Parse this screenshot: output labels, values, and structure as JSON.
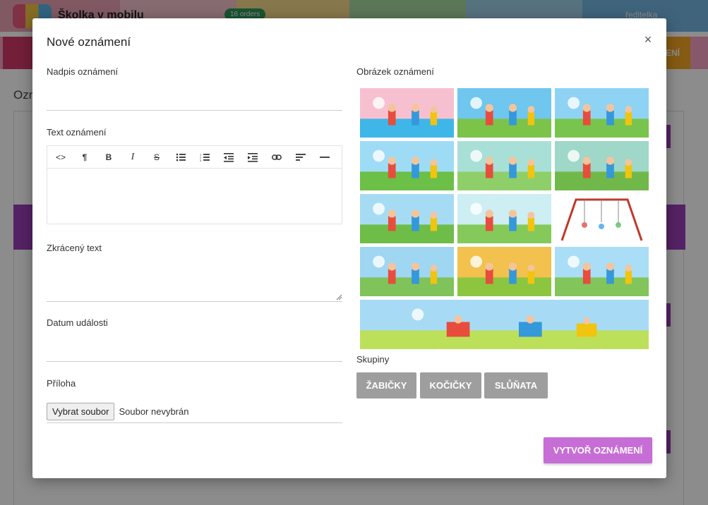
{
  "background": {
    "brand_name": "Školka v mobilu",
    "orders_badge": "16 orders",
    "role": "ředitelka",
    "nav_right_label": "ENÍ",
    "page_title": "Ozn",
    "topbar_colors": [
      "#e9a3b5",
      "#f4c4cc",
      "#f6d98a",
      "#a8d8a0",
      "#9fd0e8",
      "#74b6e2"
    ],
    "navbar_colors": [
      "#d33a6a",
      "#f4a0c0",
      "#f5a623"
    ]
  },
  "modal": {
    "title": "Nové oznámení",
    "close_icon": "close-icon",
    "fields": {
      "headline_label": "Nadpis oznámení",
      "headline_value": "",
      "text_label": "Text oznámení",
      "short_text_label": "Zkrácený text",
      "short_text_value": "",
      "event_date_label": "Datum události",
      "event_date_value": "",
      "attachment_label": "Příloha",
      "file_button": "Vybrat soubor",
      "file_status": "Soubor nevybrán"
    },
    "editor_toolbar": [
      {
        "icon": "code-icon",
        "glyph": "<>"
      },
      {
        "icon": "paragraph-icon",
        "glyph": "¶"
      },
      {
        "icon": "bold-icon",
        "glyph": "B"
      },
      {
        "icon": "italic-icon",
        "glyph": "I"
      },
      {
        "icon": "strikethrough-icon",
        "glyph": "S"
      },
      {
        "icon": "bullet-list-icon",
        "glyph": ""
      },
      {
        "icon": "numbered-list-icon",
        "glyph": ""
      },
      {
        "icon": "outdent-icon",
        "glyph": ""
      },
      {
        "icon": "indent-icon",
        "glyph": ""
      },
      {
        "icon": "link-icon",
        "glyph": ""
      },
      {
        "icon": "align-left-icon",
        "glyph": ""
      },
      {
        "icon": "horizontal-rule-icon",
        "glyph": ""
      }
    ],
    "image_label": "Obrázek oznámení",
    "images": [
      {
        "name": "rainbow-kids-image",
        "sky": "#f7c0d0",
        "ground": "#3fb6e8"
      },
      {
        "name": "kids-lying-grass-image",
        "sky": "#6fc6ee",
        "ground": "#7cc34a"
      },
      {
        "name": "kids-kite-image",
        "sky": "#8fd3f4",
        "ground": "#78c44c"
      },
      {
        "name": "kids-forest-image",
        "sky": "#9edcf5",
        "ground": "#6cbf47"
      },
      {
        "name": "unicorn-rider-image",
        "sky": "#a8e0d8",
        "ground": "#8fcf6a"
      },
      {
        "name": "sandbox-image",
        "sky": "#9fd7c8",
        "ground": "#71b84a"
      },
      {
        "name": "seesaw-image",
        "sky": "#a6dcf3",
        "ground": "#6dbd48"
      },
      {
        "name": "party-flags-image",
        "sky": "#cdeef2",
        "ground": "#86c95b"
      },
      {
        "name": "swing-set-image",
        "sky": "#ffffff",
        "ground": "#ffffff"
      },
      {
        "name": "school-bus-image",
        "sky": "#9fd6f2",
        "ground": "#7fc35a"
      },
      {
        "name": "yellow-bus-image",
        "sky": "#f2c14e",
        "ground": "#8cc63f"
      },
      {
        "name": "boy-bench-image",
        "sky": "#a9def6",
        "ground": "#82c55a"
      },
      {
        "name": "playground-banner-image",
        "sky": "#a7dbf5",
        "ground": "#bde05a"
      }
    ],
    "groups_label": "Skupiny",
    "groups": [
      "ŽABIČKY",
      "KOČIČKY",
      "SLŮŇATA"
    ],
    "submit_label": "VYTVOŘ OZNÁMENÍ",
    "accent_color": "#c76dd6",
    "group_color": "#9e9e9e"
  }
}
